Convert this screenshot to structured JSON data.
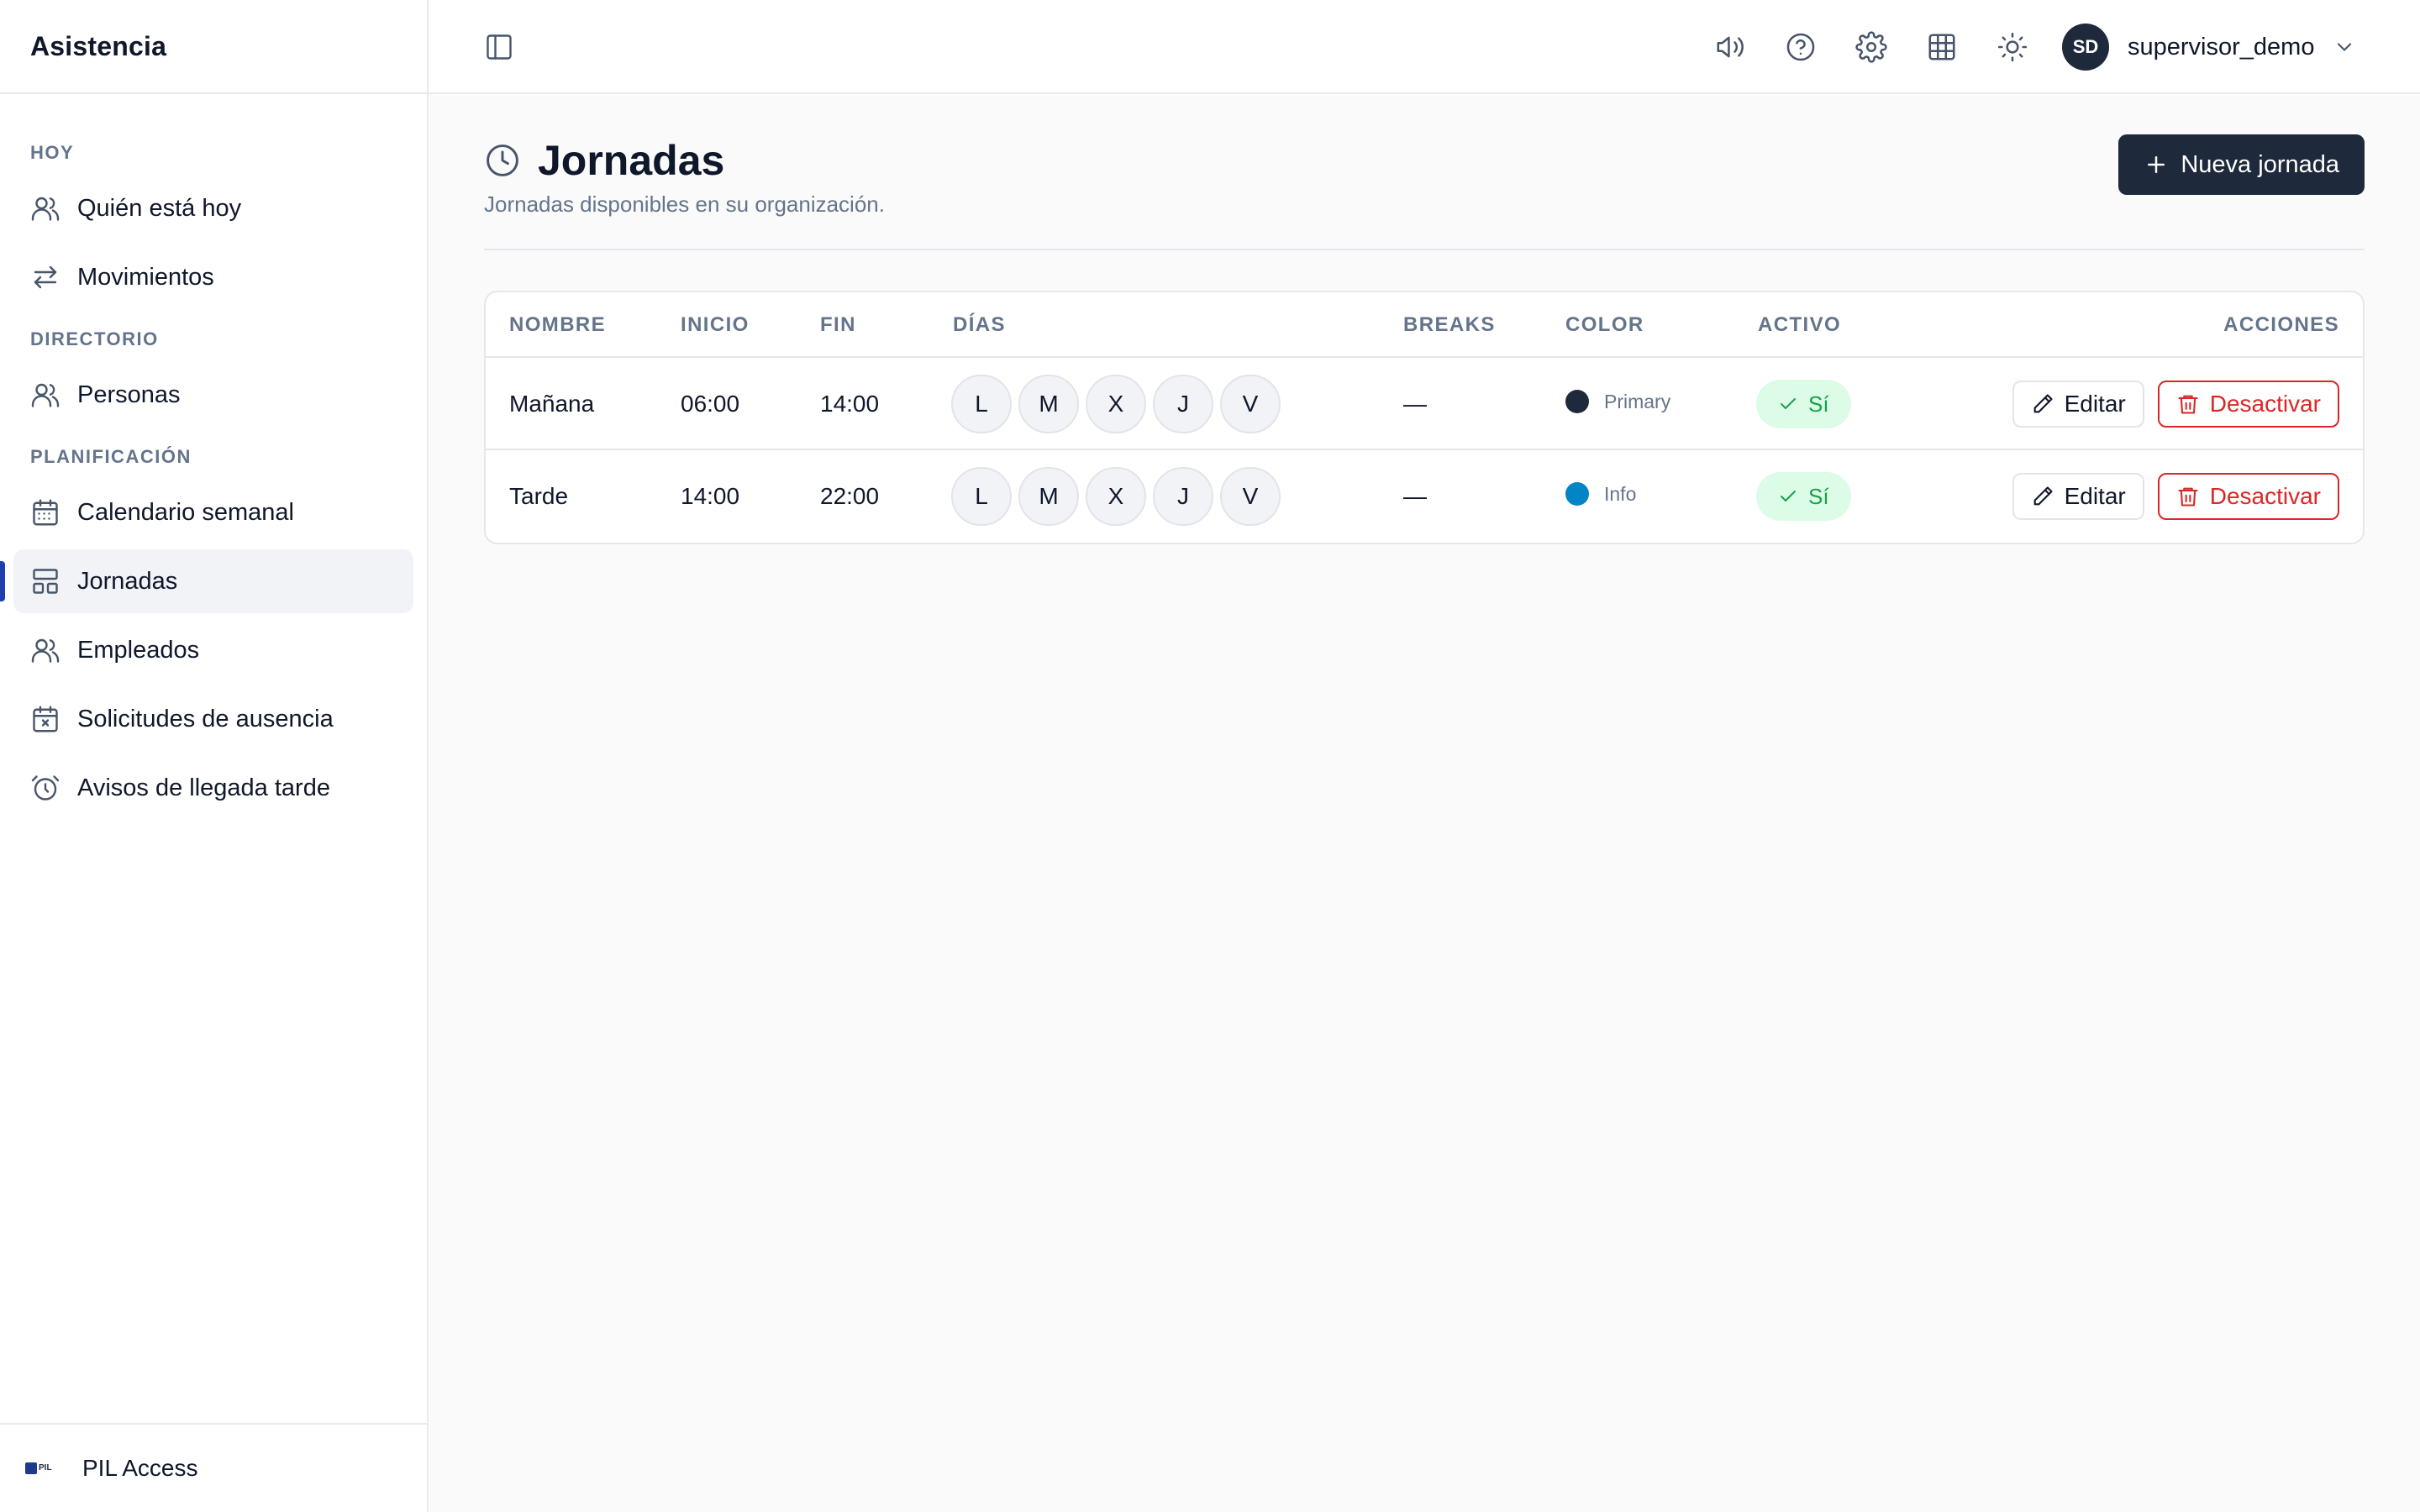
{
  "app": {
    "title": "Asistencia"
  },
  "sidebar": {
    "sections": [
      {
        "title": "HOY",
        "items": [
          {
            "label": "Quién está hoy",
            "icon": "users-icon"
          },
          {
            "label": "Movimientos",
            "icon": "arrows-left-right-icon"
          }
        ]
      },
      {
        "title": "DIRECTORIO",
        "items": [
          {
            "label": "Personas",
            "icon": "users-icon"
          }
        ]
      },
      {
        "title": "PLANIFICACIÓN",
        "items": [
          {
            "label": "Calendario semanal",
            "icon": "calendar-icon"
          },
          {
            "label": "Jornadas",
            "icon": "layout-icon",
            "active": true
          },
          {
            "label": "Empleados",
            "icon": "users-icon"
          },
          {
            "label": "Solicitudes de ausencia",
            "icon": "calendar-x-icon"
          },
          {
            "label": "Avisos de llegada tarde",
            "icon": "alarm-clock-icon"
          }
        ]
      }
    ],
    "footer": {
      "org_name": "PIL Access",
      "logo_text": "PIL"
    }
  },
  "topbar": {
    "icons": [
      "sidebar-toggle-icon",
      "megaphone-icon",
      "help-icon",
      "settings-icon",
      "grid-icon",
      "sun-icon"
    ],
    "user": {
      "initials": "SD",
      "name": "supervisor_demo"
    }
  },
  "page": {
    "title": "Jornadas",
    "subtitle": "Jornadas disponibles en su organización.",
    "new_button": "Nueva jornada"
  },
  "table": {
    "columns": {
      "name": "NOMBRE",
      "start": "INICIO",
      "end": "FIN",
      "days": "DÍAS",
      "breaks": "BREAKS",
      "color": "COLOR",
      "active": "ACTIVO",
      "actions": "ACCIONES"
    },
    "rows": [
      {
        "name": "Mañana",
        "start": "06:00",
        "end": "14:00",
        "days": [
          "L",
          "M",
          "X",
          "J",
          "V"
        ],
        "breaks": "—",
        "color_label": "Primary",
        "color_hex": "#1e293b",
        "active": "Sí",
        "edit_label": "Editar",
        "deactivate_label": "Desactivar"
      },
      {
        "name": "Tarde",
        "start": "14:00",
        "end": "22:00",
        "days": [
          "L",
          "M",
          "X",
          "J",
          "V"
        ],
        "breaks": "—",
        "color_label": "Info",
        "color_hex": "#0284c7",
        "active": "Sí",
        "edit_label": "Editar",
        "deactivate_label": "Desactivar"
      }
    ]
  },
  "colors": {
    "accent": "#1e40af",
    "primary_button": "#1e293b",
    "danger": "#dc2626",
    "success_bg": "#dcfce7",
    "success_text": "#16a34a"
  }
}
